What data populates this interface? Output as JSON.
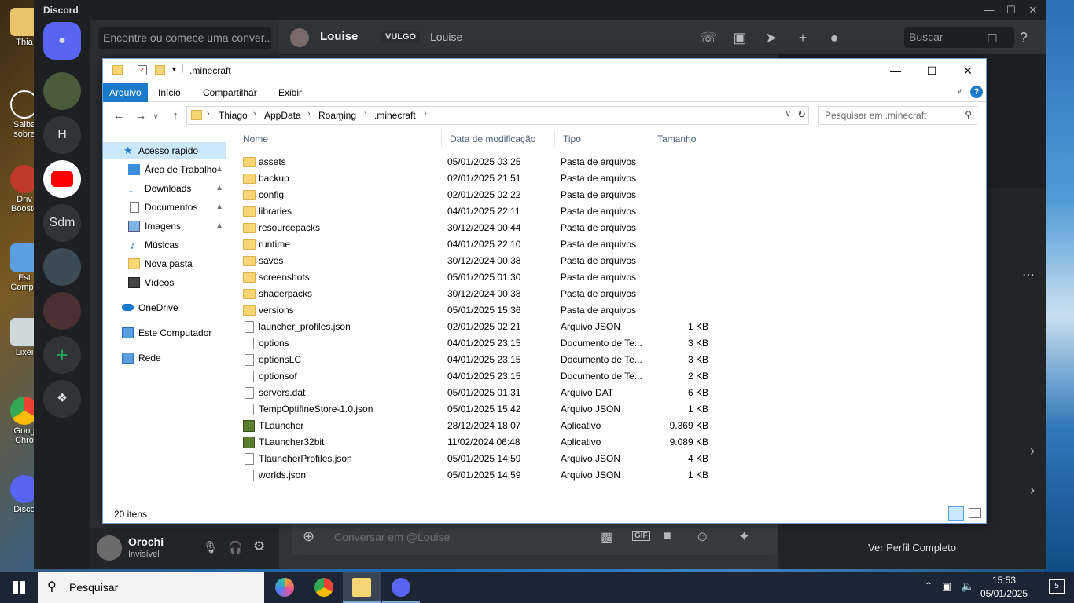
{
  "desktop": {
    "icons": [
      {
        "label": "Thia"
      },
      {
        "label": "Saiba sobre"
      },
      {
        "label": "Driv Booste"
      },
      {
        "label": "Est Compu"
      },
      {
        "label": "Lixei"
      },
      {
        "label": "Goog Chro"
      },
      {
        "label": "Disco"
      }
    ]
  },
  "discord": {
    "app_name": "Discord",
    "search_placeholder": "Encontre ou comece uma conver...",
    "servers": [
      {
        "label": "H"
      },
      {
        "label": "Sdm"
      }
    ],
    "dm_user": "Louise",
    "dm_tag": "VULGO",
    "dm_tag_name": "Louise",
    "header_search": "Buscar",
    "chat_placeholder": "Conversar em @Louise",
    "me_name": "Orochi",
    "me_status": "Invisível",
    "view_profile": "Ver Perfil Completo"
  },
  "explorer": {
    "title": ".minecraft",
    "ribbon_tabs": [
      "Arquivo",
      "Início",
      "Compartilhar",
      "Exibir"
    ],
    "breadcrumb": [
      "Thiago",
      "AppData",
      "Roaming",
      ".minecraft"
    ],
    "search_placeholder": "Pesquisar em .minecraft",
    "nav": [
      {
        "label": "Acesso rápido",
        "selected": true,
        "pinned": false
      },
      {
        "label": "Área de Trabalho",
        "selected": false,
        "pinned": true
      },
      {
        "label": "Downloads",
        "selected": false,
        "pinned": true
      },
      {
        "label": "Documentos",
        "selected": false,
        "pinned": true
      },
      {
        "label": "Imagens",
        "selected": false,
        "pinned": true
      },
      {
        "label": "Músicas",
        "selected": false,
        "pinned": false
      },
      {
        "label": "Nova pasta",
        "selected": false,
        "pinned": false
      },
      {
        "label": "Vídeos",
        "selected": false,
        "pinned": false
      },
      {
        "label": "OneDrive",
        "selected": false,
        "pinned": false
      },
      {
        "label": "Este Computador",
        "selected": false,
        "pinned": false
      },
      {
        "label": "Rede",
        "selected": false,
        "pinned": false
      }
    ],
    "columns": [
      "Nome",
      "Data de modificação",
      "Tipo",
      "Tamanho"
    ],
    "files": [
      {
        "name": "assets",
        "date": "05/01/2025 03:25",
        "type": "Pasta de arquivos",
        "size": "",
        "icon": "folder"
      },
      {
        "name": "backup",
        "date": "02/01/2025 21:51",
        "type": "Pasta de arquivos",
        "size": "",
        "icon": "folder"
      },
      {
        "name": "config",
        "date": "02/01/2025 02:22",
        "type": "Pasta de arquivos",
        "size": "",
        "icon": "folder"
      },
      {
        "name": "libraries",
        "date": "04/01/2025 22:11",
        "type": "Pasta de arquivos",
        "size": "",
        "icon": "folder"
      },
      {
        "name": "resourcepacks",
        "date": "30/12/2024 00:44",
        "type": "Pasta de arquivos",
        "size": "",
        "icon": "folder"
      },
      {
        "name": "runtime",
        "date": "04/01/2025 22:10",
        "type": "Pasta de arquivos",
        "size": "",
        "icon": "folder"
      },
      {
        "name": "saves",
        "date": "30/12/2024 00:38",
        "type": "Pasta de arquivos",
        "size": "",
        "icon": "folder"
      },
      {
        "name": "screenshots",
        "date": "05/01/2025 01:30",
        "type": "Pasta de arquivos",
        "size": "",
        "icon": "folder"
      },
      {
        "name": "shaderpacks",
        "date": "30/12/2024 00:38",
        "type": "Pasta de arquivos",
        "size": "",
        "icon": "folder"
      },
      {
        "name": "versions",
        "date": "05/01/2025 15:36",
        "type": "Pasta de arquivos",
        "size": "",
        "icon": "folder"
      },
      {
        "name": "launcher_profiles.json",
        "date": "02/01/2025 02:21",
        "type": "Arquivo JSON",
        "size": "1 KB",
        "icon": "file"
      },
      {
        "name": "options",
        "date": "04/01/2025 23:15",
        "type": "Documento de Te...",
        "size": "3 KB",
        "icon": "file"
      },
      {
        "name": "optionsLC",
        "date": "04/01/2025 23:15",
        "type": "Documento de Te...",
        "size": "3 KB",
        "icon": "file"
      },
      {
        "name": "optionsof",
        "date": "04/01/2025 23:15",
        "type": "Documento de Te...",
        "size": "2 KB",
        "icon": "file"
      },
      {
        "name": "servers.dat",
        "date": "05/01/2025 01:31",
        "type": "Arquivo DAT",
        "size": "6 KB",
        "icon": "file"
      },
      {
        "name": "TempOptifineStore-1.0.json",
        "date": "05/01/2025 15:42",
        "type": "Arquivo JSON",
        "size": "1 KB",
        "icon": "file"
      },
      {
        "name": "TLauncher",
        "date": "28/12/2024 18:07",
        "type": "Aplicativo",
        "size": "9.369 KB",
        "icon": "app"
      },
      {
        "name": "TLauncher32bit",
        "date": "11/02/2024 06:48",
        "type": "Aplicativo",
        "size": "9.089 KB",
        "icon": "app"
      },
      {
        "name": "TlauncherProfiles.json",
        "date": "05/01/2025 14:59",
        "type": "Arquivo JSON",
        "size": "4 KB",
        "icon": "file"
      },
      {
        "name": "worlds.json",
        "date": "05/01/2025 14:59",
        "type": "Arquivo JSON",
        "size": "1 KB",
        "icon": "file"
      }
    ],
    "status": "20 itens"
  },
  "taskbar": {
    "search": "Pesquisar",
    "time": "15:53",
    "date": "05/01/2025",
    "notifications": "5"
  }
}
